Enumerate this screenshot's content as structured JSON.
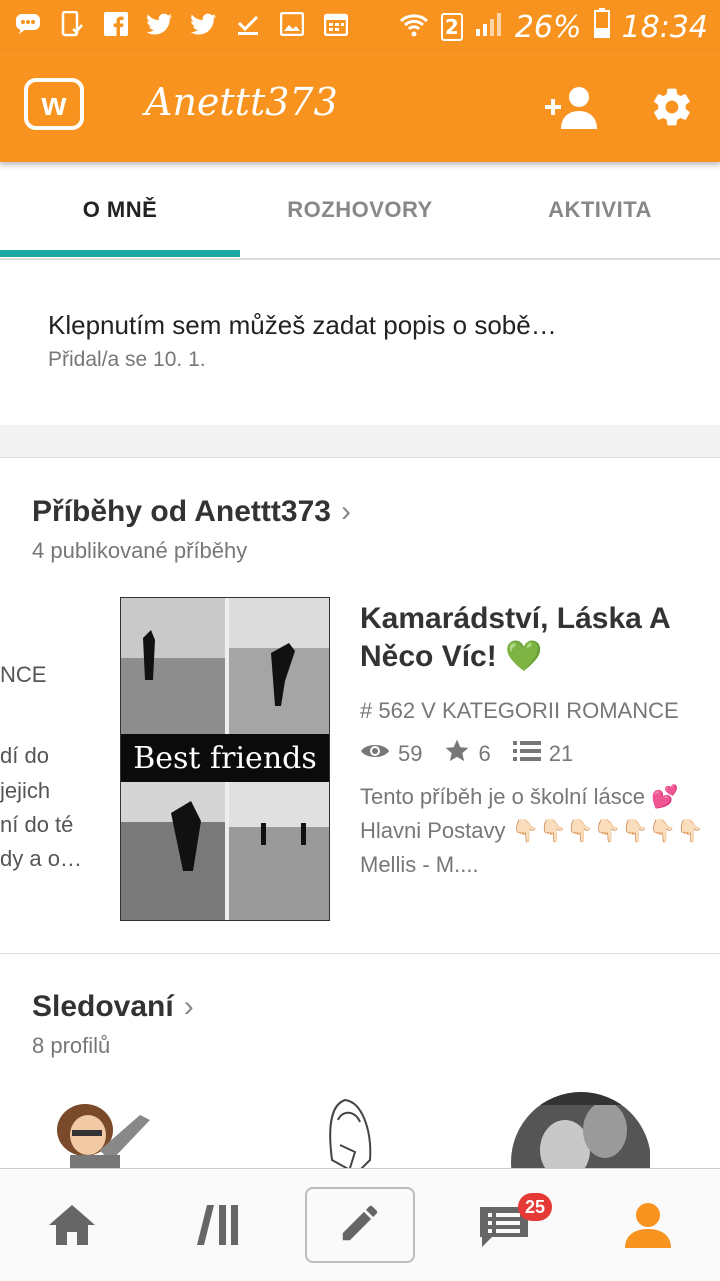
{
  "status_bar": {
    "battery": "26%",
    "time": "18:34",
    "sim": "2"
  },
  "app_bar": {
    "username": "Anettt373",
    "logo_letter": "w"
  },
  "tabs": [
    {
      "label": "O MNĚ",
      "active": true
    },
    {
      "label": "ROZHOVORY",
      "active": false
    },
    {
      "label": "AKTIVITA",
      "active": false
    }
  ],
  "about": {
    "placeholder": "Klepnutím sem můžeš zadat popis o sobě…",
    "joined": "Přidal/a se 10. 1."
  },
  "stories": {
    "title": "Příběhy od Anettt373",
    "subtitle": "4 publikované příběhy",
    "peek_lines": [
      "NCE",
      "dí do",
      "jejich",
      "ní do té",
      "dy a o…"
    ],
    "item": {
      "cover_text": "Best friends",
      "title": "Kamarádství, Láska A Něco Víc! 💚",
      "rank": "# 562 V KATEGORII ROMANCE",
      "reads": "59",
      "votes": "6",
      "parts": "21",
      "description": "Tento příběh je o školní lásce 💕 Hlavni Postavy 👇🏻👇🏻👇🏻👇🏻👇🏻👇🏻👇🏻 Mellis - M...."
    }
  },
  "following": {
    "title": "Sledovaní",
    "subtitle": "8 profilů"
  },
  "bottom_nav": {
    "items": [
      "home-icon",
      "library-icon",
      "write-icon",
      "messages-icon",
      "profile-icon"
    ],
    "badge": "25",
    "active_color": "#f7931e"
  },
  "colors": {
    "accent": "#f7931e",
    "tab_indicator": "#1ca8a0",
    "badge": "#e53935"
  }
}
